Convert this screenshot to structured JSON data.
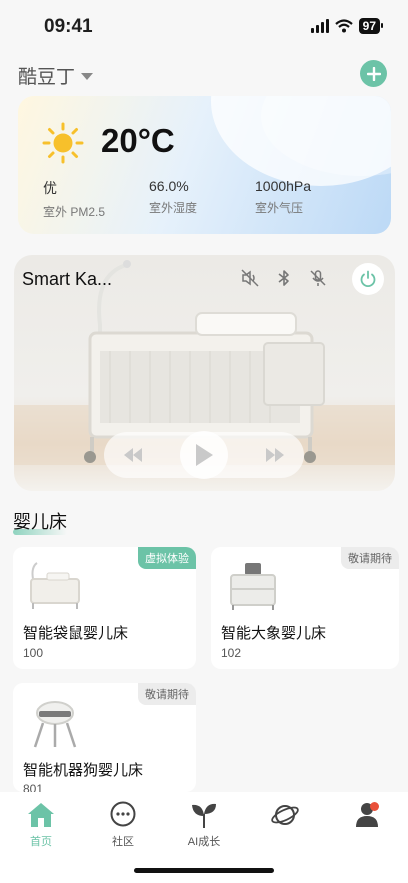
{
  "status": {
    "time": "09:41",
    "battery": "97"
  },
  "header": {
    "home_name": "酷豆丁"
  },
  "weather": {
    "temperature": "20°C",
    "metrics": [
      {
        "value": "优",
        "label": "室外 PM2.5"
      },
      {
        "value": "66.0%",
        "label": "室外湿度"
      },
      {
        "value": "1000hPa",
        "label": "室外气压"
      }
    ]
  },
  "device": {
    "name": "Smart Ka..."
  },
  "section": {
    "title": "婴儿床"
  },
  "products": [
    {
      "name": "智能袋鼠婴儿床",
      "number": "100",
      "tag": "虚拟体验"
    },
    {
      "name": "智能大象婴儿床",
      "number": "102",
      "tag": "敬请期待"
    },
    {
      "name": "智能机器狗婴儿床",
      "number": "801",
      "tag": "敬请期待"
    }
  ],
  "tabs": [
    {
      "label": "首页"
    },
    {
      "label": "社区"
    },
    {
      "label": "AI成长"
    },
    {
      "label": ""
    },
    {
      "label": ""
    }
  ],
  "colors": {
    "accent": "#6cc3a7",
    "badge": "#e9503a"
  }
}
